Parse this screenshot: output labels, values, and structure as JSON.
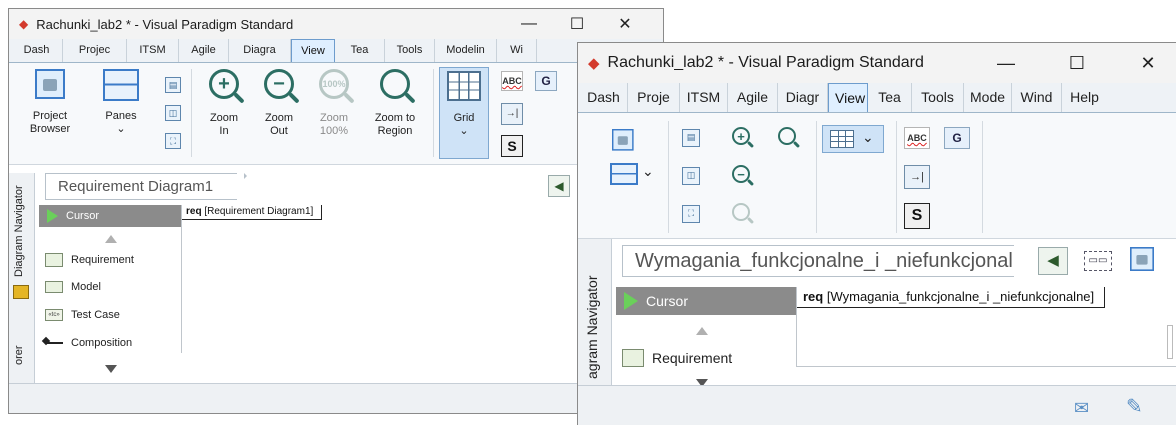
{
  "window1": {
    "title": "Rachunki_lab2 * - Visual Paradigm Standard",
    "controls": {
      "minimize": "—",
      "maximize": "☐",
      "close": "✕"
    },
    "tabs": [
      "Dash",
      "Projec",
      "ITSM",
      "Agile",
      "Diagra",
      "View",
      "Tea",
      "Tools",
      "Modelin",
      "Wi"
    ],
    "active_tab": "View",
    "ribbon": {
      "project_browser": "Project Browser",
      "project_browser_l1": "Project",
      "project_browser_l2": "Browser",
      "panes_l1": "Panes",
      "panes_l2": "⌄",
      "zoom_in_l1": "Zoom",
      "zoom_in_l2": "In",
      "zoom_out_l1": "Zoom",
      "zoom_out_l2": "Out",
      "zoom_100_l1": "Zoom",
      "zoom_100_l2": "100%",
      "zoom_region_l1": "Zoom to",
      "zoom_region_l2": "Region",
      "grid_l1": "Grid",
      "grid_l2": "⌄",
      "spell": "ABC",
      "s_label": "S",
      "arrow": "→|"
    },
    "breadcrumb": "Requirement Diagram1",
    "navigator_label": "Diagram Navigator",
    "explorer_label": "orer",
    "palette": {
      "cursor": "Cursor",
      "items": [
        "Requirement",
        "Model",
        "Test Case",
        "Composition"
      ]
    },
    "frame_keyword": "req",
    "frame_name": "[Requirement Diagram1]"
  },
  "window2": {
    "title": "Rachunki_lab2 * - Visual Paradigm Standard",
    "controls": {
      "minimize": "—",
      "maximize": "☐",
      "close": "✕"
    },
    "tabs": [
      "Dash",
      "Proje",
      "ITSM",
      "Agile",
      "Diagr",
      "View",
      "Tea",
      "Tools",
      "Mode",
      "Wind",
      "Help"
    ],
    "active_tab": "View",
    "ribbon": {
      "spell": "ABC",
      "s_label": "S",
      "g_label": "G",
      "arrow": "→|",
      "grid_dropdown": "⌄",
      "panes_dropdown": "⌄"
    },
    "breadcrumb": "Wymagania_funkcjonalne_i _niefunkcjonaln",
    "navigator_label": "agram Navigator",
    "palette": {
      "cursor": "Cursor",
      "items": [
        "Requirement"
      ]
    },
    "frame_keyword": "req",
    "frame_name": "[Wymagania_funkcjonalne_i _niefunkcjonalne]"
  },
  "colors": {
    "accent": "#6d9ccd",
    "active_tab_bg": "#dfefff",
    "cursor_row": "#8b8b8b",
    "logo": "#d33a2c"
  }
}
